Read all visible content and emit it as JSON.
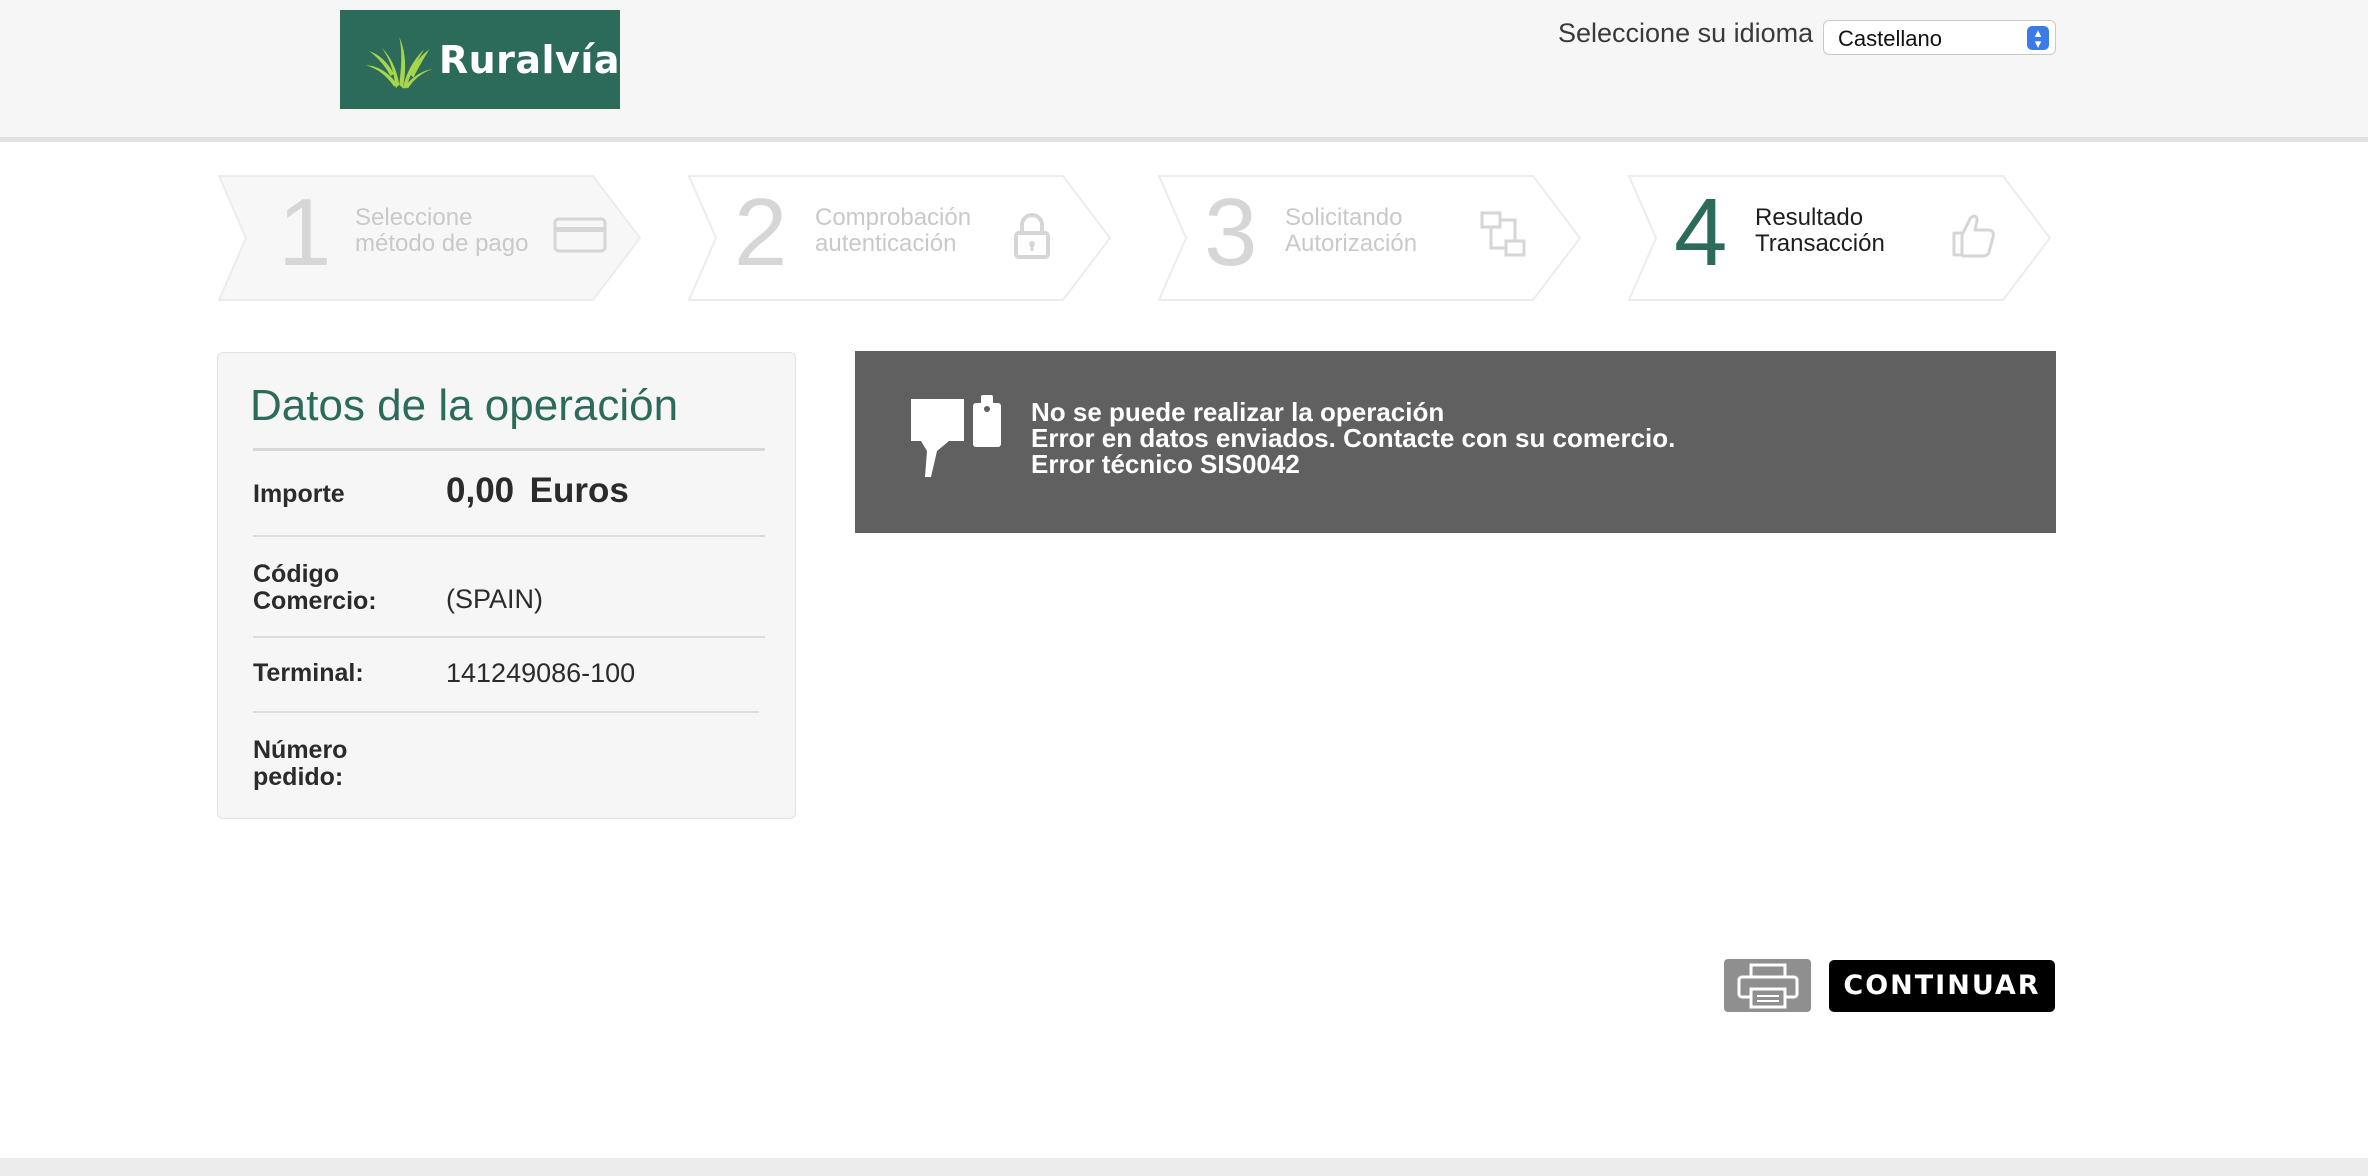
{
  "header": {
    "logo_text": "Ruralvía",
    "language_label": "Seleccione su idioma",
    "language_selected": "Castellano"
  },
  "steps": [
    {
      "number": "1",
      "line1": "Seleccione",
      "line2": "método de pago",
      "icon": "credit-card-icon"
    },
    {
      "number": "2",
      "line1": "Comprobación",
      "line2": "autenticación",
      "icon": "lock-icon"
    },
    {
      "number": "3",
      "line1": "Solicitando",
      "line2": "Autorización",
      "icon": "transfer-icon"
    },
    {
      "number": "4",
      "line1": "Resultado",
      "line2": "Transacción",
      "icon": "thumbs-up-icon"
    }
  ],
  "operation": {
    "title": "Datos de la operación",
    "amount_label": "Importe",
    "amount_value": "0,00",
    "amount_currency": "Euros",
    "merchant_label_line1": "Código",
    "merchant_label_line2": "Comercio:",
    "merchant_value": "(SPAIN)",
    "terminal_label": "Terminal:",
    "terminal_value": "141249086-100",
    "order_label_line1": "Número",
    "order_label_line2": "pedido:",
    "order_value": ""
  },
  "error": {
    "line1": "No se puede realizar la operación",
    "line2": "Error en datos enviados. Contacte con su comercio.",
    "line3": "Error técnico SIS0042"
  },
  "actions": {
    "continue_label": "CONTINUAR"
  },
  "colors": {
    "brand": "#2c6a5a",
    "error_bg": "#606061"
  }
}
